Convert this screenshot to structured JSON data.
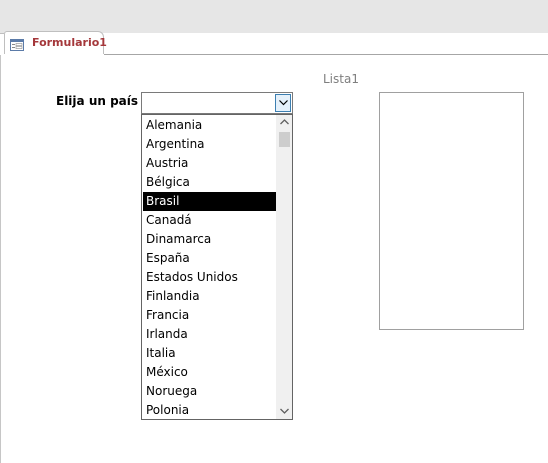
{
  "tab": {
    "label": "Formulario1",
    "icon": "form-icon"
  },
  "form": {
    "combo_label": "Elija un país",
    "combo_value": "",
    "list_label": "Lista1"
  },
  "dropdown": {
    "items": [
      "Alemania",
      "Argentina",
      "Austria",
      "Bélgica",
      "Brasil",
      "Canadá",
      "Dinamarca",
      "España",
      "Estados Unidos",
      "Finlandia",
      "Francia",
      "Irlanda",
      "Italia",
      "México",
      "Noruega",
      "Polonia"
    ],
    "selected": "Brasil"
  },
  "colors": {
    "tab_text": "#a4373a",
    "selection_bg": "#000000",
    "selection_text": "#ffffff",
    "topbar_bg": "#e6e6e6"
  }
}
